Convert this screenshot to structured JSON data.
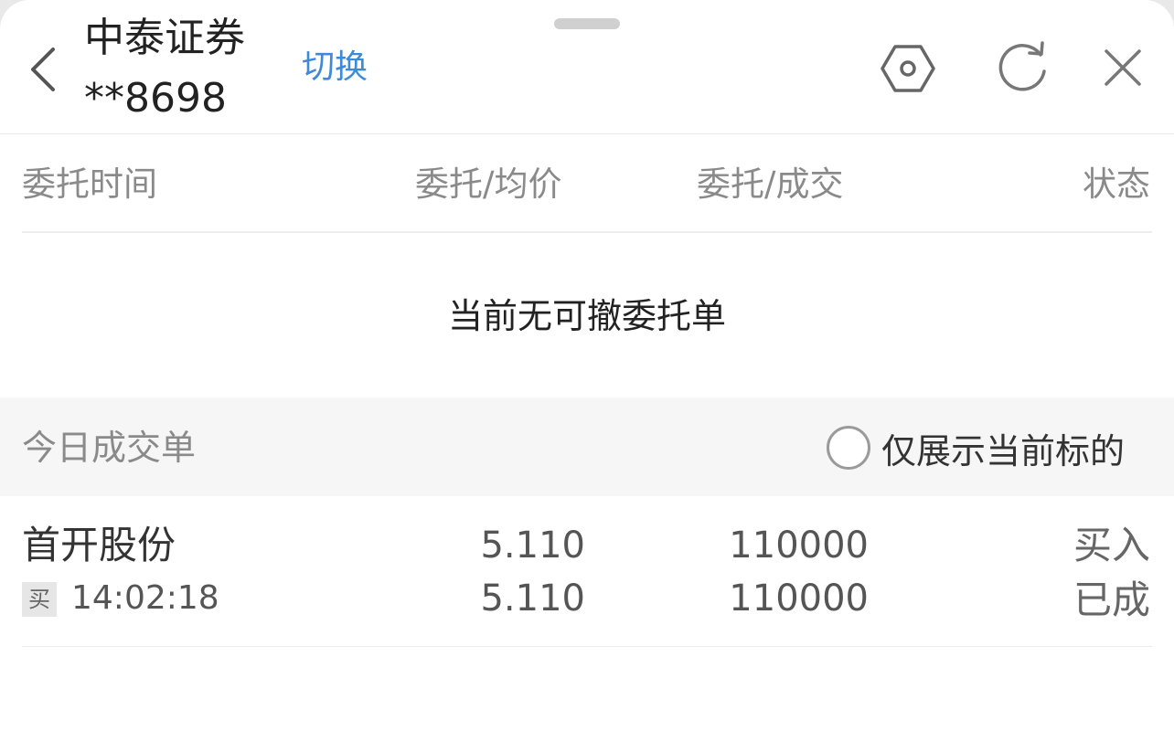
{
  "header": {
    "broker_name": "中泰证券",
    "account_masked": "**8698",
    "switch_label": "切换",
    "icons": [
      "chevron-left-icon",
      "settings-hexagon-icon",
      "refresh-icon",
      "close-icon"
    ]
  },
  "orders": {
    "columns": {
      "time": "委托时间",
      "price": "委托/均价",
      "quantity": "委托/成交",
      "status": "状态"
    },
    "empty_message": "当前无可撤委托单"
  },
  "today_trades": {
    "title": "今日成交单",
    "filter_label": "仅展示当前标的",
    "filter_checked": false,
    "rows": [
      {
        "name": "首开股份",
        "side_badge": "买",
        "time": "14:02:18",
        "order_price": "5.110",
        "avg_price": "5.110",
        "order_qty": "110000",
        "filled_qty": "110000",
        "side": "买入",
        "status": "已成"
      }
    ]
  },
  "colors": {
    "accent": "#3f8ad8",
    "text_primary": "#222222",
    "text_muted": "#8a8a8a",
    "section_bg": "#f6f6f6"
  }
}
